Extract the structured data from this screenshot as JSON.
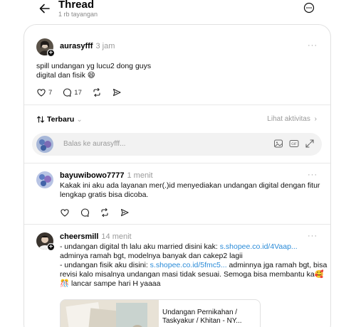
{
  "header": {
    "title": "Thread",
    "views": "1 rb tayangan"
  },
  "post": {
    "username": "aurasyfff",
    "time": "3 jam",
    "text_line1": "spill undangan yg lucu2 dong guys",
    "text_line2": "digital dan fisik 😄",
    "likes": "7",
    "replies": "17"
  },
  "sort": {
    "label": "Terbaru",
    "activity": "Lihat aktivitas"
  },
  "reply_box": {
    "placeholder": "Balas ke aurasyfff..."
  },
  "comments": [
    {
      "username": "bayuwibowo7777",
      "time": "1 menit",
      "line1": "Kakak ini aku ada layanan mer(.)id menyediakan undangan digital dengan fitur",
      "line2": "lengkap gratis bisa dicoba."
    },
    {
      "username": "cheersmill",
      "time": "14 menit",
      "line1a": "- undangan digital th lalu aku married disini kak: ",
      "line1link": "s.shopee.co.id/4Vaap...",
      "line2": "adminya ramah bgt, modelnya banyak dan cakep2 lagii",
      "line3a": "- undangan fisik aku disini: ",
      "line3link": "s.shopee.co.id/5fmc5...",
      "line3b": " adminnya jga ramah bgt, bisa",
      "line4": "revisi kalo misalnya undangan masi tidak sesuai. Semoga bisa membantu ka🥰",
      "line5": "🎊 lancar sampe hari H yaaaa",
      "link_card_title": "Undangan Pernikahan / Taskyakur / Khitan - NY..."
    }
  ],
  "colors": {
    "link": "#2a8bd8",
    "muted": "#9a9a9a"
  }
}
